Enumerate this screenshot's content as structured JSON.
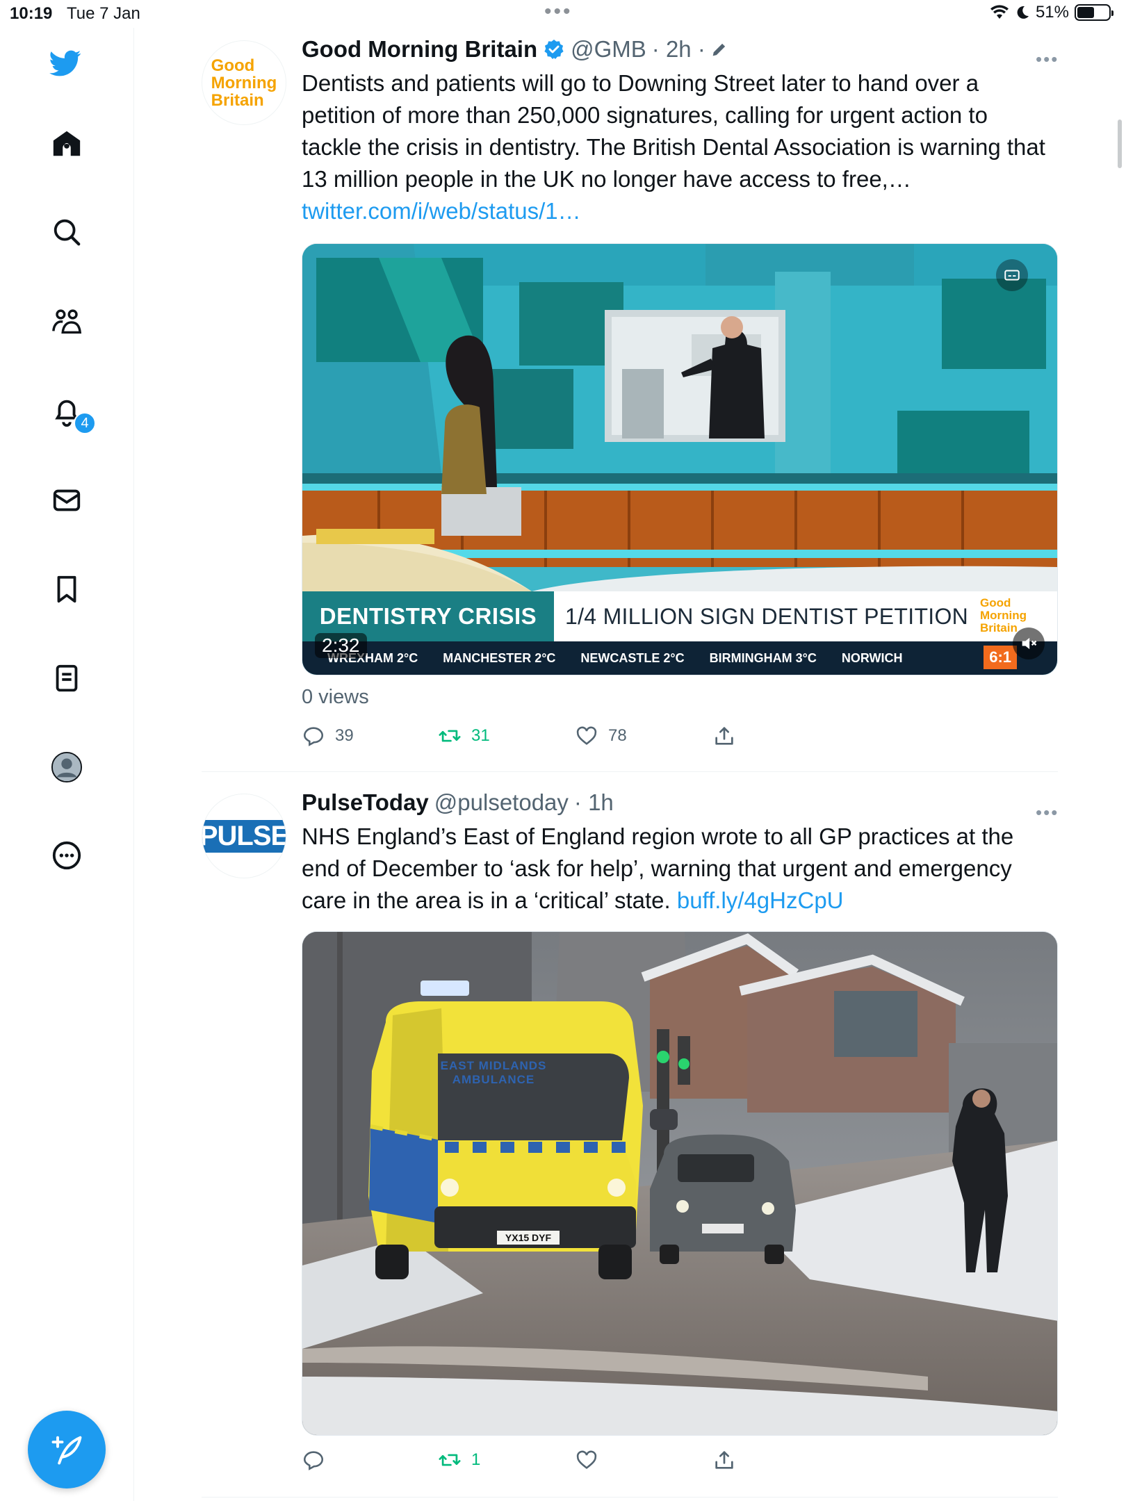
{
  "status_bar": {
    "time": "10:19",
    "date": "Tue 7 Jan",
    "battery": "51%"
  },
  "sidebar": {
    "notifications_badge": "4"
  },
  "tweets": [
    {
      "avatar_text": [
        "Good",
        "Morning",
        "Britain"
      ],
      "name": "Good Morning Britain",
      "handle": "@GMB",
      "time": "· 2h ·",
      "text": "Dentists and patients will go to Downing Street later to hand over a petition of more than 250,000 signatures, calling for urgent action to tackle the crisis in dentistry. The British Dental Association is warning that 13 million people in the UK no longer have access to free,…",
      "link": "twitter.com/i/web/status/1…",
      "video": {
        "strap_title": "DENTISTRY CRISIS",
        "strap_subtitle": "1/4 MILLION SIGN DENTIST PETITION",
        "strap_logo": [
          "Good",
          "Morning",
          "Britain"
        ],
        "ticker": [
          "WREXHAM 2°C",
          "MANCHESTER 2°C",
          "NEWCASTLE 2°C",
          "BIRMINGHAM 3°C",
          "NORWICH"
        ],
        "ticker_clock": "6:1",
        "duration": "2:32"
      },
      "views": "0 views",
      "replies": "39",
      "retweets": "31",
      "likes": "78"
    },
    {
      "avatar_text": "PULSE",
      "name": "PulseToday",
      "handle": "@pulsetoday",
      "time": "· 1h",
      "text": "NHS England’s East of England region wrote to all GP practices at the end of December to ‘ask for help’, warning that urgent and emergency care in the area is in a ‘critical’ state. ",
      "link": "buff.ly/4gHzCpU",
      "image": {
        "ambulance_label": "EAST MIDLANDS AMBULANCE",
        "plate": "YX15 DYF"
      },
      "replies": "",
      "retweets": "1",
      "likes": ""
    }
  ],
  "colors": {
    "accent": "#1d9bf0",
    "retweet": "#00ba7c",
    "text": "#0f1419",
    "muted": "#536471"
  }
}
